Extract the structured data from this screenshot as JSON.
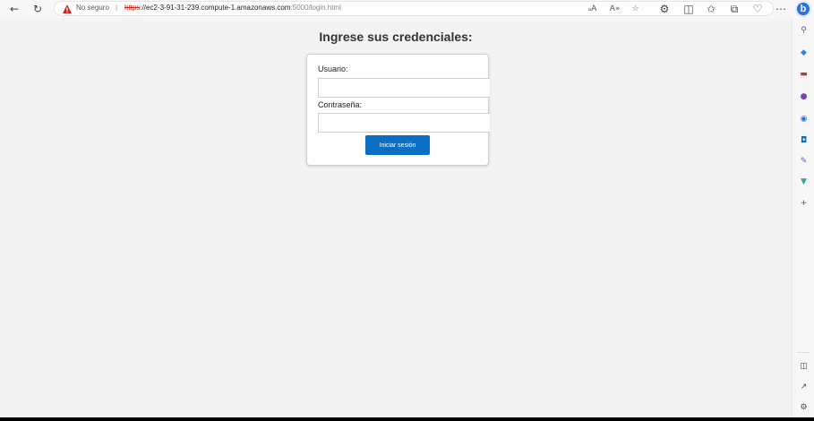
{
  "browser": {
    "security_label": "No seguro",
    "separator": "|",
    "url_scheme": "https",
    "url_rest_host": "://ec2-3-91-31-239.compute-1.amazonaws.com",
    "url_path": ":5000/login.html"
  },
  "page": {
    "title": "Ingrese sus credenciales:",
    "username_label": "Usuario:",
    "username_value": "",
    "password_label": "Contraseña:",
    "password_value": "",
    "submit_label": "Iniciar sesión"
  },
  "icons": {
    "back": "back-arrow-icon",
    "refresh": "refresh-icon",
    "warning": "warning-icon",
    "read_aloud": "read-aloud-icon",
    "favorite": "star-icon",
    "bing": "bing-icon"
  },
  "colors": {
    "accent": "#0a6fc2",
    "warning": "#c42b1c",
    "page_bg": "#f3f3f3"
  }
}
